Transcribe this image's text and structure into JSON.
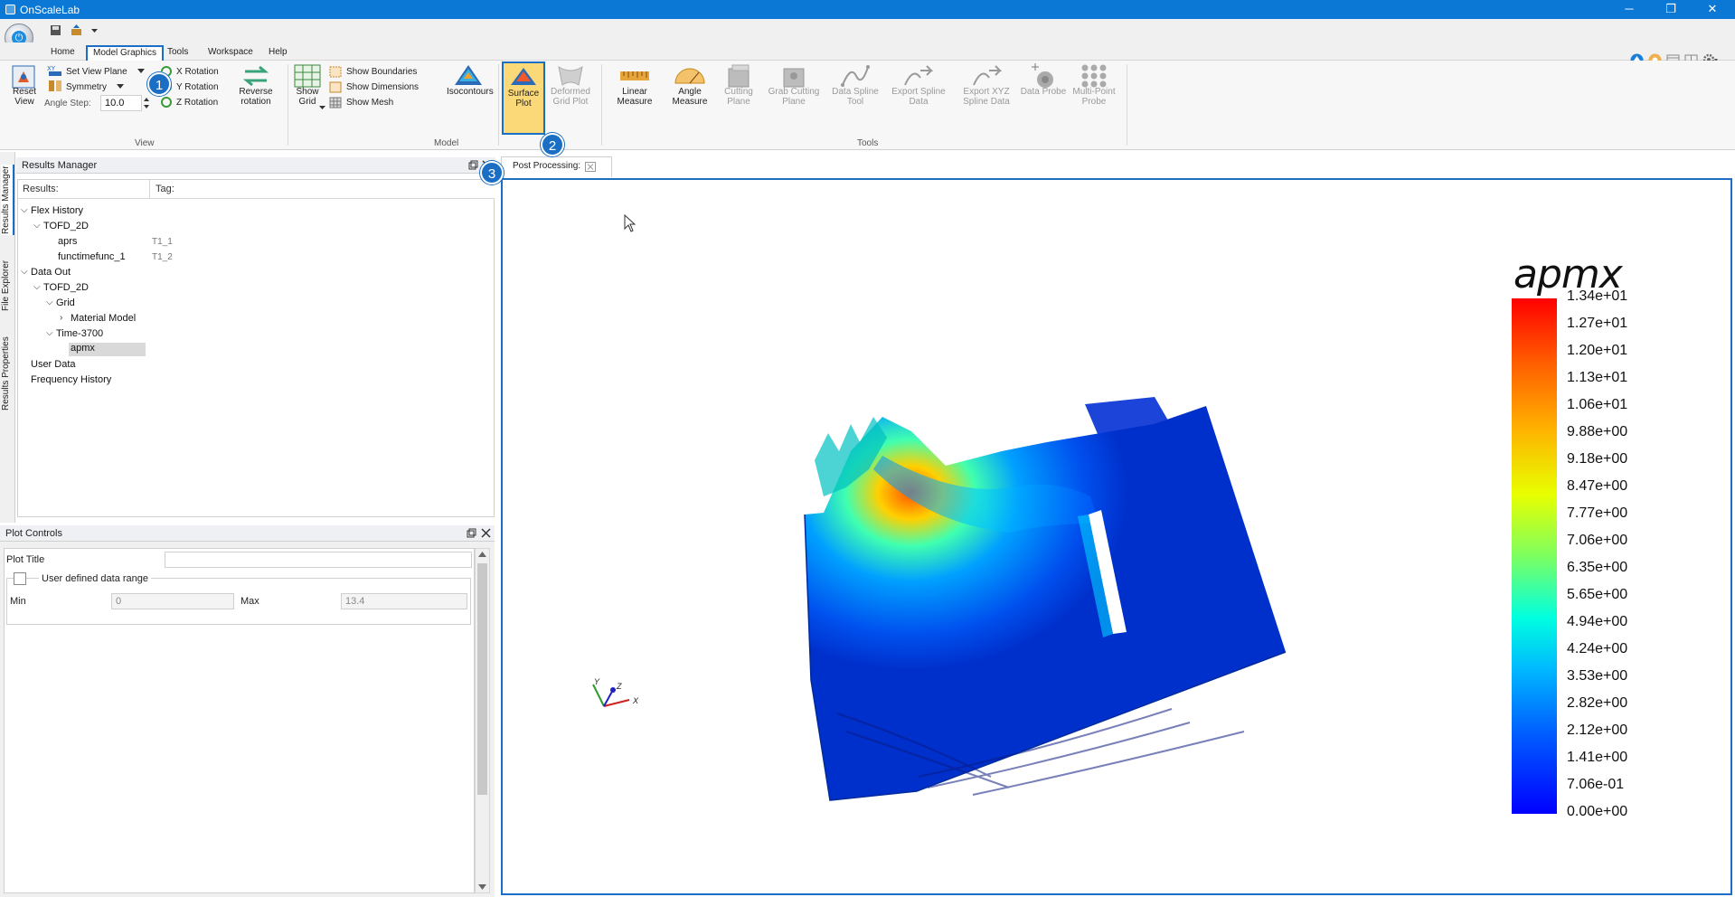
{
  "window": {
    "title": "OnScaleLab",
    "minimize": "─",
    "restore": "❐",
    "close": "✕"
  },
  "ribbon_tabs": [
    "Home",
    "Model Graphics",
    "Tools",
    "Workspace",
    "Help"
  ],
  "ribbon": {
    "reset_view": "Reset View",
    "set_view_plane": "Set View Plane",
    "symmetry": "Symmetry",
    "angle_step_label": "Angle Step:",
    "angle_step_value": "10.0",
    "x_rotation": "X Rotation",
    "y_rotation": "Y Rotation",
    "z_rotation": "Z Rotation",
    "reverse_rotation": "Reverse rotation",
    "show_grid": "Show Grid",
    "show_boundaries": "Show Boundaries",
    "show_dimensions": "Show Dimensions",
    "show_mesh": "Show Mesh",
    "isocontours": "Isocontours",
    "surface_plot": "Surface Plot",
    "deformed_grid_plot": "Deformed Grid Plot",
    "linear_measure": "Linear Measure",
    "angle_measure": "Angle Measure",
    "cutting_plane": "Cutting Plane",
    "grab_cutting_plane": "Grab Cutting Plane",
    "data_spline_tool": "Data Spline Tool",
    "export_spline_data": "Export Spline Data",
    "export_xyz_spline_data": "Export XYZ Spline Data",
    "data_probe": "Data Probe",
    "multi_point_probe": "Multi-Point Probe",
    "group_view": "View",
    "group_model": "Model",
    "group_tools": "Tools"
  },
  "badges": [
    "1",
    "2",
    "3"
  ],
  "side_tabs": [
    "Results Manager",
    "File Explorer",
    "Results Properties"
  ],
  "results_manager": {
    "title": "Results Manager",
    "col_results": "Results:",
    "col_tag": "Tag:",
    "tree": [
      {
        "label": "Flex History",
        "tag": ""
      },
      {
        "label": "TOFD_2D",
        "tag": ""
      },
      {
        "label": "aprs",
        "tag": "T1_1"
      },
      {
        "label": "functimefunc_1",
        "tag": "T1_2"
      },
      {
        "label": "Data Out",
        "tag": ""
      },
      {
        "label": "TOFD_2D",
        "tag": ""
      },
      {
        "label": "Grid",
        "tag": ""
      },
      {
        "label": "Material Model",
        "tag": ""
      },
      {
        "label": "Time-3700",
        "tag": ""
      },
      {
        "label": "apmx",
        "tag": ""
      },
      {
        "label": "User Data",
        "tag": ""
      },
      {
        "label": "Frequency History",
        "tag": ""
      }
    ]
  },
  "plot_controls": {
    "title": "Plot Controls",
    "plot_title_label": "Plot Title",
    "plot_title_value": "",
    "user_range_label": "User defined data range",
    "min_label": "Min",
    "min_value": "0",
    "max_label": "Max",
    "max_value": "13.4"
  },
  "document_tab": "Post Processing:",
  "legend": {
    "title": "apmx",
    "ticks": [
      "1.34e+01",
      "1.27e+01",
      "1.20e+01",
      "1.13e+01",
      "1.06e+01",
      "9.88e+00",
      "9.18e+00",
      "8.47e+00",
      "7.77e+00",
      "7.06e+00",
      "6.35e+00",
      "5.65e+00",
      "4.94e+00",
      "4.24e+00",
      "3.53e+00",
      "2.82e+00",
      "2.12e+00",
      "1.41e+00",
      "7.06e-01",
      "0.00e+00"
    ]
  },
  "axes_triad": {
    "x": "X",
    "y": "Y",
    "z": "Z"
  },
  "colors": {
    "accent": "#1a6fc4",
    "titlebar": "#0a78d4",
    "highlight": "#f2c12e"
  }
}
